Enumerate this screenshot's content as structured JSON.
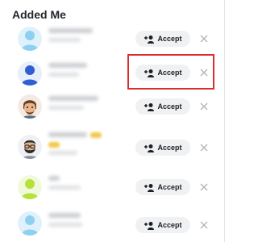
{
  "section": {
    "title": "Added Me"
  },
  "rows": [
    {
      "avatar": "light-blue-silhouette-avatar",
      "accept_label": "Accept",
      "dismiss_icon": "close-icon"
    },
    {
      "avatar": "blue-silhouette-avatar",
      "accept_label": "Accept",
      "dismiss_icon": "close-icon",
      "highlighted": true
    },
    {
      "avatar": "bitmoji-brown-hair-avatar",
      "accept_label": "Accept",
      "dismiss_icon": "close-icon"
    },
    {
      "avatar": "bitmoji-beard-glasses-avatar",
      "accept_label": "Accept",
      "dismiss_icon": "close-icon"
    },
    {
      "avatar": "lime-green-silhouette-avatar",
      "accept_label": "Accept",
      "dismiss_icon": "close-icon"
    },
    {
      "avatar": "light-blue-silhouette-avatar",
      "accept_label": "Accept",
      "dismiss_icon": "close-icon"
    }
  ],
  "colors": {
    "highlight": "#d92d2f",
    "button_bg": "#f0f1f3",
    "title": "#23262b",
    "light_blue_avatar": "#8fd0f2",
    "blue_avatar": "#2f5fd0",
    "green_avatar": "#b6e03a"
  }
}
